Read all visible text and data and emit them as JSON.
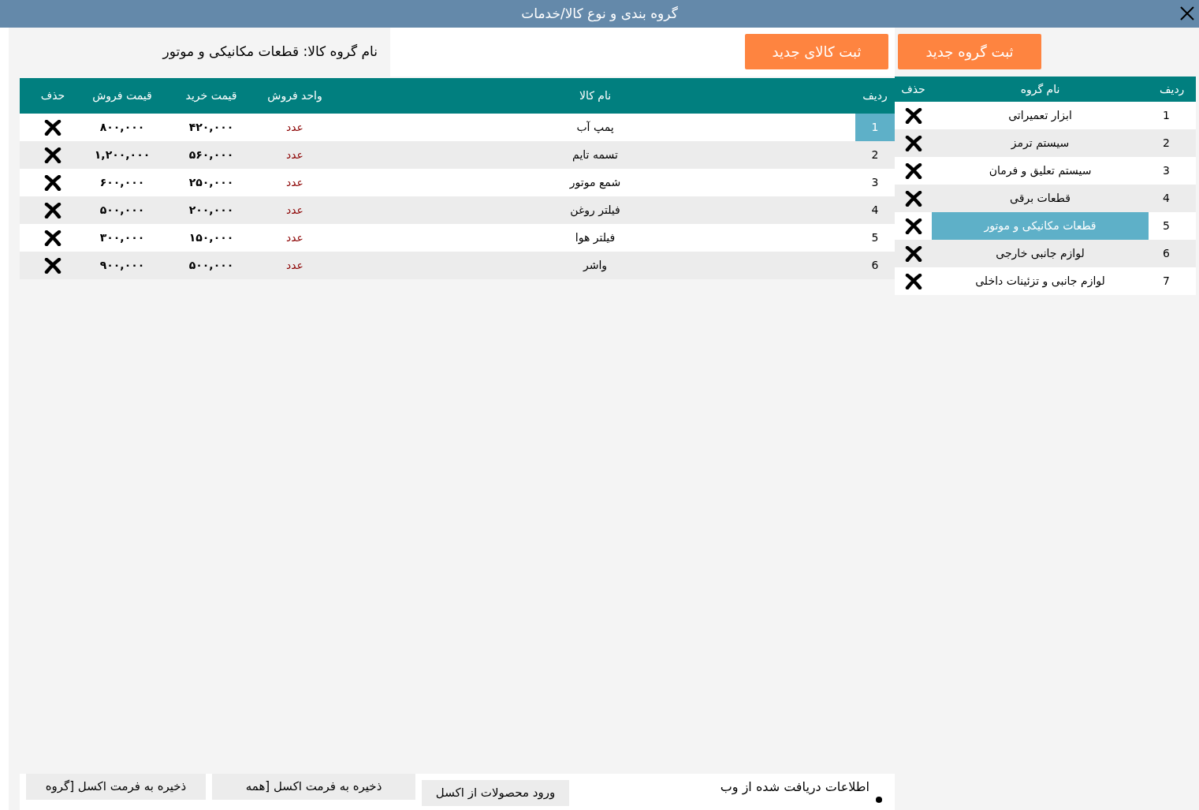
{
  "window": {
    "title": "گروه بندی و نوع کالا/خدمات"
  },
  "groups_panel": {
    "new_button": "ثبت گروه جدید",
    "columns": [
      "ردیف",
      "نام گروه",
      "حذف"
    ],
    "rows": [
      {
        "index": "1",
        "name": "ابزار تعمیراتی",
        "selected": false
      },
      {
        "index": "2",
        "name": "سیستم ترمز",
        "selected": false
      },
      {
        "index": "3",
        "name": "سیستم تعلیق و فرمان",
        "selected": false
      },
      {
        "index": "4",
        "name": "قطعات برقی",
        "selected": false
      },
      {
        "index": "5",
        "name": "قطعات مکانیکی و موتور",
        "selected": true
      },
      {
        "index": "6",
        "name": "لوازم جانبی خارجی",
        "selected": false
      },
      {
        "index": "7",
        "name": "لوازم جانبی و تزئینات داخلی",
        "selected": false
      }
    ]
  },
  "goods_panel": {
    "group_label": "نام گروه کالا: قطعات مکانیکی و موتور",
    "new_button": "ثبت کالای جدید",
    "columns": [
      "ردیف",
      "نام کالا",
      "واحد فروش",
      "قیمت خرید",
      "قیمت فروش",
      "حذف"
    ],
    "rows": [
      {
        "index": "1",
        "name": "پمپ آب",
        "unit": "عدد",
        "buy": "۴۲۰,۰۰۰",
        "sell": "۸۰۰,۰۰۰",
        "selected": true
      },
      {
        "index": "2",
        "name": "تسمه تایم",
        "unit": "عدد",
        "buy": "۵۶۰,۰۰۰",
        "sell": "۱,۲۰۰,۰۰۰",
        "selected": false
      },
      {
        "index": "3",
        "name": "شمع موتور",
        "unit": "عدد",
        "buy": "۲۵۰,۰۰۰",
        "sell": "۶۰۰,۰۰۰",
        "selected": false
      },
      {
        "index": "4",
        "name": "فیلتر روغن",
        "unit": "عدد",
        "buy": "۲۰۰,۰۰۰",
        "sell": "۵۰۰,۰۰۰",
        "selected": false
      },
      {
        "index": "5",
        "name": "فیلتر هوا",
        "unit": "عدد",
        "buy": "۱۵۰,۰۰۰",
        "sell": "۳۰۰,۰۰۰",
        "selected": false
      },
      {
        "index": "6",
        "name": "واشر",
        "unit": "عدد",
        "buy": "۵۰۰,۰۰۰",
        "sell": "۹۰۰,۰۰۰",
        "selected": false
      }
    ]
  },
  "footer": {
    "web_info": "اطلاعات دریافت شده از وب",
    "buttons": [
      "ورود محصولات از اکسل",
      "ذخیره به فرمت اکسل [همه",
      "ذخیره به فرمت اکسل [گروه"
    ]
  }
}
